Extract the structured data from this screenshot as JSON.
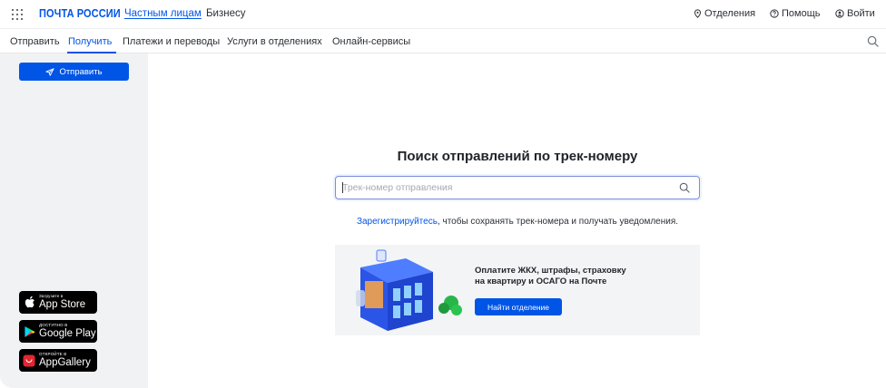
{
  "header": {
    "logo": "ПОЧТА РОССИИ",
    "links": [
      "Частным лицам",
      "Бизнесу"
    ],
    "right": {
      "offices": "Отделения",
      "help": "Помощь",
      "login": "Войти"
    }
  },
  "nav": {
    "items": [
      "Отправить",
      "Получить",
      "Платежи и переводы",
      "Услуги в отделениях",
      "Онлайн-сервисы"
    ],
    "active": "Получить"
  },
  "sidebar": {
    "send_button": "Отправить",
    "badges": [
      {
        "small": "Загрузите в",
        "big": "App Store",
        "icon": "apple-icon"
      },
      {
        "small": "ДОСТУПНО В",
        "big": "Google Play",
        "icon": "google-play-icon"
      },
      {
        "small": "ОТКРОЙТЕ В",
        "big": "AppGallery",
        "icon": "huawei-icon"
      }
    ]
  },
  "tracking": {
    "title": "Поиск отправлений по трек-номеру",
    "placeholder": "Трек-номер отправления",
    "register_link": "Зарегистрируйтесь",
    "register_rest": ", чтобы сохранять трек-номера и получать уведомления."
  },
  "banner": {
    "line1": "Оплатите ЖКХ, штрафы, страховку",
    "line2": "на квартиру и ОСАГО на Почте",
    "button": "Найти отделение"
  },
  "colors": {
    "accent": "#0055e6",
    "sidebar_bg": "#f1f2f4",
    "banner_bg": "#f3f4f6"
  }
}
